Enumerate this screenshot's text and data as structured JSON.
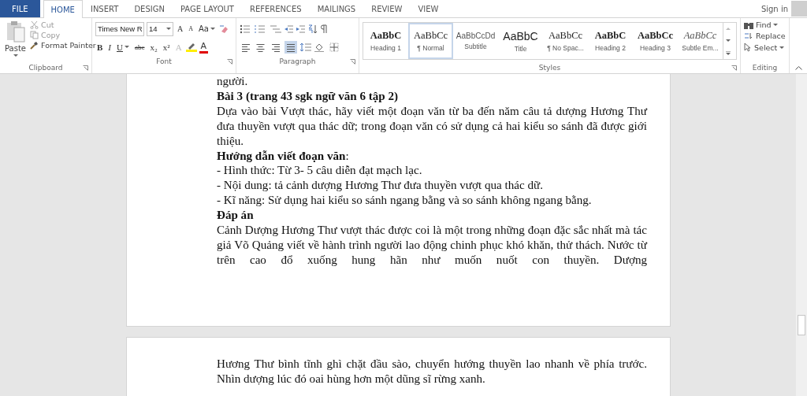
{
  "tabs": [
    {
      "label": "FILE",
      "kind": "file",
      "selected": false
    },
    {
      "label": "HOME",
      "kind": "tab",
      "selected": true
    },
    {
      "label": "INSERT",
      "kind": "tab",
      "selected": false
    },
    {
      "label": "DESIGN",
      "kind": "tab",
      "selected": false
    },
    {
      "label": "PAGE LAYOUT",
      "kind": "tab",
      "selected": false
    },
    {
      "label": "REFERENCES",
      "kind": "tab",
      "selected": false
    },
    {
      "label": "MAILINGS",
      "kind": "tab",
      "selected": false
    },
    {
      "label": "REVIEW",
      "kind": "tab",
      "selected": false
    },
    {
      "label": "VIEW",
      "kind": "tab",
      "selected": false
    }
  ],
  "account": {
    "label": "Sign in"
  },
  "clipboard": {
    "label": "Clipboard",
    "paste": "Paste",
    "cut": "Cut",
    "copy": "Copy",
    "format_painter": "Format Painter"
  },
  "font": {
    "label": "Font",
    "family": "Times New R",
    "size": "14",
    "grow": "A",
    "shrink": "A",
    "change_case": "Aa",
    "bold": "B",
    "italic": "I",
    "underline": "U",
    "strikethrough": "abc",
    "subscript": "x₂",
    "superscript": "x²",
    "effects": "A",
    "font_color": "A"
  },
  "paragraph": {
    "label": "Paragraph",
    "alignments": [
      {
        "kind": "left",
        "selected": false
      },
      {
        "kind": "center",
        "selected": false
      },
      {
        "kind": "right",
        "selected": false
      },
      {
        "kind": "justify",
        "selected": true
      }
    ]
  },
  "styles": {
    "label": "Styles",
    "items": [
      {
        "preview": "AaBbC",
        "label": "Heading 1",
        "kind": "heading",
        "selected": false
      },
      {
        "preview": "AaBbCc",
        "label": "¶ Normal",
        "kind": "normal",
        "selected": true
      },
      {
        "preview": "AaBbCcDd",
        "label": "Subtitle",
        "kind": "subtitle",
        "selected": false
      },
      {
        "preview": "AaBbC",
        "label": "Title",
        "kind": "title",
        "selected": false
      },
      {
        "preview": "AaBbCc",
        "label": "¶ No Spac...",
        "kind": "normal",
        "selected": false
      },
      {
        "preview": "AaBbC",
        "label": "Heading 2",
        "kind": "heading",
        "selected": false
      },
      {
        "preview": "AaBbCc",
        "label": "Heading 3",
        "kind": "heading",
        "selected": false
      },
      {
        "preview": "AaBbCc",
        "label": "Subtle Em...",
        "kind": "emphasis",
        "selected": false
      }
    ]
  },
  "editing": {
    "label": "Editing",
    "find": "Find",
    "replace": "Replace",
    "select": "Select"
  },
  "pages": [
    {
      "continues": true,
      "paragraphs": [
        {
          "text": "người.",
          "bold": false
        },
        {
          "text": "Bài 3 (trang 43 sgk ngữ văn 6 tập 2)",
          "bold": true
        },
        {
          "text": "Dựa vào bài Vượt thác, hãy viết một đoạn văn từ ba đến năm câu tả dượng Hương Thư đưa thuyền vượt qua thác dữ; trong đoạn văn có sử dụng cả hai kiểu so sánh đã được giới thiệu.",
          "bold": false
        },
        {
          "text": "**Hướng dẫn viết đoạn văn**:",
          "bold": false
        },
        {
          "text": "- Hình thức: Từ 3- 5 câu diễn đạt mạch lạc.",
          "bold": false
        },
        {
          "text": "- Nội dung: tả cảnh dượng Hương Thư đưa thuyền vượt qua thác dữ.",
          "bold": false
        },
        {
          "text": "- Kĩ năng: Sử dụng hai kiểu so sánh ngang bằng và so sánh không ngang bằng.",
          "bold": false
        },
        {
          "text": "Đáp án",
          "bold": true
        },
        {
          "text": "Cảnh Dượng Hương Thư vượt thác được coi là một trong những đoạn đặc sắc nhất mà tác giả Võ Quảng viết về hành trình người lao động chinh phục khó khăn, thử thách. Nước từ trên cao đổ xuống hung hãn như muốn nuốt con thuyền. Dượng",
          "bold": false
        }
      ]
    },
    {
      "continues": false,
      "paragraphs": [
        {
          "text": "Hương Thư bình tĩnh ghì chặt đầu sào, chuyển hướng thuyền lao nhanh về phía trước. Nhìn dượng lúc đó oai hùng hơn một dũng sĩ rừng xanh.",
          "bold": false
        }
      ]
    }
  ]
}
